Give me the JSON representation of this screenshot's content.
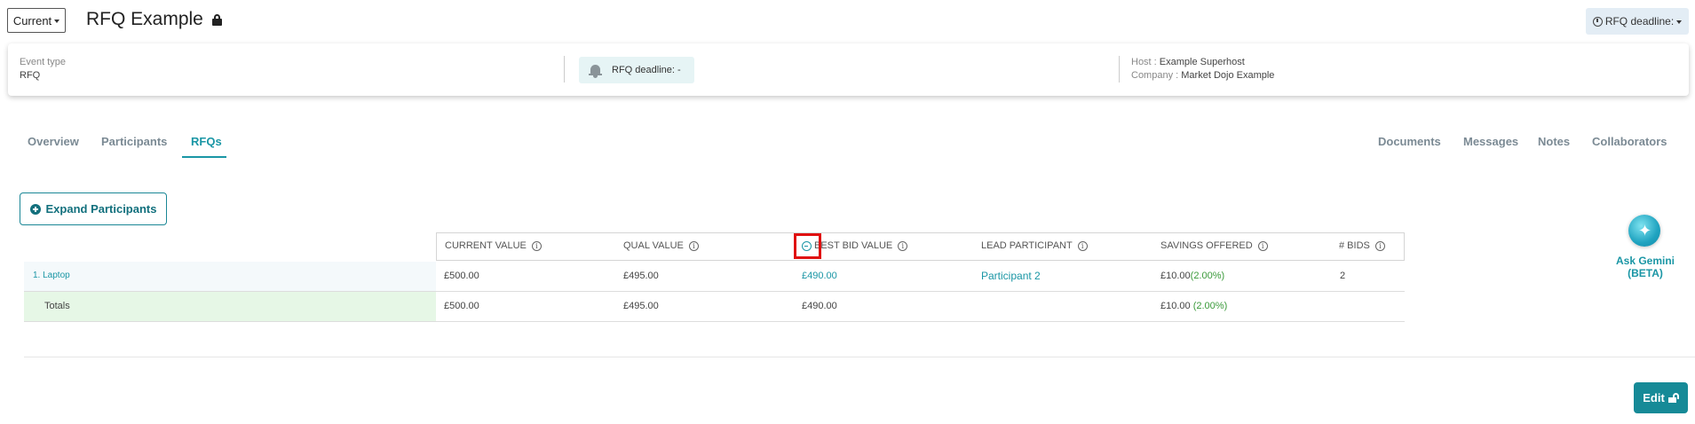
{
  "header": {
    "version_select": "Current",
    "title": "RFQ Example",
    "deadline_button": "RFQ deadline:"
  },
  "info": {
    "event_type_label": "Event type",
    "event_type_value": "RFQ",
    "deadline_pill": "RFQ deadline: -",
    "host_label": "Host :",
    "host_value": "Example Superhost",
    "company_label": "Company :",
    "company_value": "Market Dojo Example"
  },
  "tabs": {
    "left": [
      "Overview",
      "Participants",
      "RFQs"
    ],
    "right": [
      "Documents",
      "Messages",
      "Notes",
      "Collaborators"
    ],
    "active": "RFQs"
  },
  "expand_button": "Expand Participants",
  "table": {
    "columns": [
      "CURRENT VALUE",
      "QUAL VALUE",
      "BEST BID VALUE",
      "LEAD PARTICIPANT",
      "SAVINGS OFFERED",
      "# BIDS"
    ],
    "rows": [
      {
        "name": "1. Laptop",
        "current": "£500.00",
        "qual": "£495.00",
        "best_bid": "£490.00",
        "lead": "Participant 2",
        "savings": "£10.00",
        "savings_pct": "(2.00%)",
        "bids": "2"
      }
    ],
    "totals": {
      "name": "Totals",
      "current": "£500.00",
      "qual": "£495.00",
      "best_bid": "£490.00",
      "savings": "£10.00",
      "savings_pct": "(2.00%)"
    }
  },
  "gemini": {
    "label": "Ask Gemini (BETA)",
    "icon": "gemini-sparkle-icon"
  },
  "edit_button": "Edit",
  "colors": {
    "accent": "#1a96a5",
    "highlight": "#e01010",
    "totals_bg": "#e6f7e6"
  }
}
